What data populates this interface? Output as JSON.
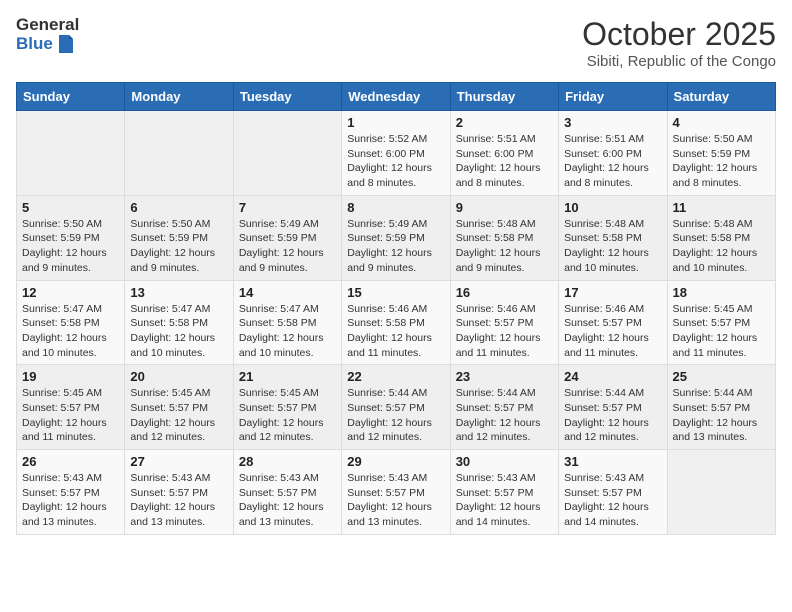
{
  "header": {
    "logo_general": "General",
    "logo_blue": "Blue",
    "month": "October 2025",
    "location": "Sibiti, Republic of the Congo"
  },
  "weekdays": [
    "Sunday",
    "Monday",
    "Tuesday",
    "Wednesday",
    "Thursday",
    "Friday",
    "Saturday"
  ],
  "weeks": [
    [
      {
        "day": "",
        "sunrise": "",
        "sunset": "",
        "daylight": ""
      },
      {
        "day": "",
        "sunrise": "",
        "sunset": "",
        "daylight": ""
      },
      {
        "day": "",
        "sunrise": "",
        "sunset": "",
        "daylight": ""
      },
      {
        "day": "1",
        "sunrise": "Sunrise: 5:52 AM",
        "sunset": "Sunset: 6:00 PM",
        "daylight": "Daylight: 12 hours and 8 minutes."
      },
      {
        "day": "2",
        "sunrise": "Sunrise: 5:51 AM",
        "sunset": "Sunset: 6:00 PM",
        "daylight": "Daylight: 12 hours and 8 minutes."
      },
      {
        "day": "3",
        "sunrise": "Sunrise: 5:51 AM",
        "sunset": "Sunset: 6:00 PM",
        "daylight": "Daylight: 12 hours and 8 minutes."
      },
      {
        "day": "4",
        "sunrise": "Sunrise: 5:50 AM",
        "sunset": "Sunset: 5:59 PM",
        "daylight": "Daylight: 12 hours and 8 minutes."
      }
    ],
    [
      {
        "day": "5",
        "sunrise": "Sunrise: 5:50 AM",
        "sunset": "Sunset: 5:59 PM",
        "daylight": "Daylight: 12 hours and 9 minutes."
      },
      {
        "day": "6",
        "sunrise": "Sunrise: 5:50 AM",
        "sunset": "Sunset: 5:59 PM",
        "daylight": "Daylight: 12 hours and 9 minutes."
      },
      {
        "day": "7",
        "sunrise": "Sunrise: 5:49 AM",
        "sunset": "Sunset: 5:59 PM",
        "daylight": "Daylight: 12 hours and 9 minutes."
      },
      {
        "day": "8",
        "sunrise": "Sunrise: 5:49 AM",
        "sunset": "Sunset: 5:59 PM",
        "daylight": "Daylight: 12 hours and 9 minutes."
      },
      {
        "day": "9",
        "sunrise": "Sunrise: 5:48 AM",
        "sunset": "Sunset: 5:58 PM",
        "daylight": "Daylight: 12 hours and 9 minutes."
      },
      {
        "day": "10",
        "sunrise": "Sunrise: 5:48 AM",
        "sunset": "Sunset: 5:58 PM",
        "daylight": "Daylight: 12 hours and 10 minutes."
      },
      {
        "day": "11",
        "sunrise": "Sunrise: 5:48 AM",
        "sunset": "Sunset: 5:58 PM",
        "daylight": "Daylight: 12 hours and 10 minutes."
      }
    ],
    [
      {
        "day": "12",
        "sunrise": "Sunrise: 5:47 AM",
        "sunset": "Sunset: 5:58 PM",
        "daylight": "Daylight: 12 hours and 10 minutes."
      },
      {
        "day": "13",
        "sunrise": "Sunrise: 5:47 AM",
        "sunset": "Sunset: 5:58 PM",
        "daylight": "Daylight: 12 hours and 10 minutes."
      },
      {
        "day": "14",
        "sunrise": "Sunrise: 5:47 AM",
        "sunset": "Sunset: 5:58 PM",
        "daylight": "Daylight: 12 hours and 10 minutes."
      },
      {
        "day": "15",
        "sunrise": "Sunrise: 5:46 AM",
        "sunset": "Sunset: 5:58 PM",
        "daylight": "Daylight: 12 hours and 11 minutes."
      },
      {
        "day": "16",
        "sunrise": "Sunrise: 5:46 AM",
        "sunset": "Sunset: 5:57 PM",
        "daylight": "Daylight: 12 hours and 11 minutes."
      },
      {
        "day": "17",
        "sunrise": "Sunrise: 5:46 AM",
        "sunset": "Sunset: 5:57 PM",
        "daylight": "Daylight: 12 hours and 11 minutes."
      },
      {
        "day": "18",
        "sunrise": "Sunrise: 5:45 AM",
        "sunset": "Sunset: 5:57 PM",
        "daylight": "Daylight: 12 hours and 11 minutes."
      }
    ],
    [
      {
        "day": "19",
        "sunrise": "Sunrise: 5:45 AM",
        "sunset": "Sunset: 5:57 PM",
        "daylight": "Daylight: 12 hours and 11 minutes."
      },
      {
        "day": "20",
        "sunrise": "Sunrise: 5:45 AM",
        "sunset": "Sunset: 5:57 PM",
        "daylight": "Daylight: 12 hours and 12 minutes."
      },
      {
        "day": "21",
        "sunrise": "Sunrise: 5:45 AM",
        "sunset": "Sunset: 5:57 PM",
        "daylight": "Daylight: 12 hours and 12 minutes."
      },
      {
        "day": "22",
        "sunrise": "Sunrise: 5:44 AM",
        "sunset": "Sunset: 5:57 PM",
        "daylight": "Daylight: 12 hours and 12 minutes."
      },
      {
        "day": "23",
        "sunrise": "Sunrise: 5:44 AM",
        "sunset": "Sunset: 5:57 PM",
        "daylight": "Daylight: 12 hours and 12 minutes."
      },
      {
        "day": "24",
        "sunrise": "Sunrise: 5:44 AM",
        "sunset": "Sunset: 5:57 PM",
        "daylight": "Daylight: 12 hours and 12 minutes."
      },
      {
        "day": "25",
        "sunrise": "Sunrise: 5:44 AM",
        "sunset": "Sunset: 5:57 PM",
        "daylight": "Daylight: 12 hours and 13 minutes."
      }
    ],
    [
      {
        "day": "26",
        "sunrise": "Sunrise: 5:43 AM",
        "sunset": "Sunset: 5:57 PM",
        "daylight": "Daylight: 12 hours and 13 minutes."
      },
      {
        "day": "27",
        "sunrise": "Sunrise: 5:43 AM",
        "sunset": "Sunset: 5:57 PM",
        "daylight": "Daylight: 12 hours and 13 minutes."
      },
      {
        "day": "28",
        "sunrise": "Sunrise: 5:43 AM",
        "sunset": "Sunset: 5:57 PM",
        "daylight": "Daylight: 12 hours and 13 minutes."
      },
      {
        "day": "29",
        "sunrise": "Sunrise: 5:43 AM",
        "sunset": "Sunset: 5:57 PM",
        "daylight": "Daylight: 12 hours and 13 minutes."
      },
      {
        "day": "30",
        "sunrise": "Sunrise: 5:43 AM",
        "sunset": "Sunset: 5:57 PM",
        "daylight": "Daylight: 12 hours and 14 minutes."
      },
      {
        "day": "31",
        "sunrise": "Sunrise: 5:43 AM",
        "sunset": "Sunset: 5:57 PM",
        "daylight": "Daylight: 12 hours and 14 minutes."
      },
      {
        "day": "",
        "sunrise": "",
        "sunset": "",
        "daylight": ""
      }
    ]
  ]
}
